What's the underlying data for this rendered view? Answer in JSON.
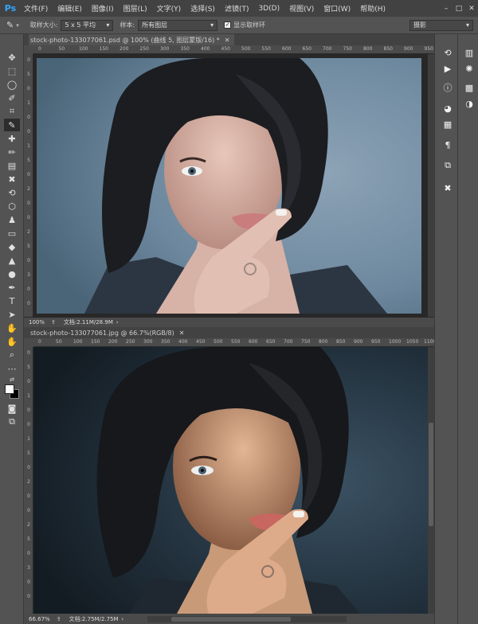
{
  "app": {
    "logo": "Ps"
  },
  "menu": [
    "文件(F)",
    "编辑(E)",
    "图像(I)",
    "图层(L)",
    "文字(Y)",
    "选择(S)",
    "滤镜(T)",
    "3D(D)",
    "视图(V)",
    "窗口(W)",
    "帮助(H)"
  ],
  "options": {
    "sample_size_label": "取样大小:",
    "sample_size_value": "5 x 5 平均",
    "sample_label": "样本:",
    "sample_value": "所有图层",
    "show_ring_label": "显示取样环",
    "workspace_value": "摄影"
  },
  "doc1": {
    "tab_title": "stock-photo-133077061.psd @ 100% (曲线 5, 图层蒙版/16) *",
    "zoom": "100%",
    "doc_size": "文档:2.11M/28.9M",
    "ruler_h": [
      "0",
      "50",
      "100",
      "150",
      "200",
      "250",
      "300",
      "350",
      "400",
      "450",
      "500",
      "550",
      "600",
      "650",
      "700",
      "750",
      "800",
      "850",
      "900",
      "950"
    ],
    "ruler_v": [
      "0",
      "5",
      "0",
      "1",
      "0",
      "0",
      "1",
      "5",
      "0",
      "2",
      "0",
      "0",
      "2",
      "5",
      "0",
      "3",
      "0",
      "0"
    ]
  },
  "doc2": {
    "tab_title": "stock-photo-133077061.jpg @ 66.7%(RGB/8)",
    "zoom": "66.67%",
    "doc_size": "文档:2.75M/2.75M",
    "ruler_h": [
      "0",
      "50",
      "100",
      "150",
      "200",
      "250",
      "300",
      "350",
      "400",
      "450",
      "500",
      "550",
      "600",
      "650",
      "700",
      "750",
      "800",
      "850",
      "900",
      "950",
      "1000",
      "1050",
      "1100"
    ],
    "ruler_v": [
      "0",
      "5",
      "0",
      "1",
      "0",
      "0",
      "1",
      "5",
      "0",
      "2",
      "0",
      "0",
      "2",
      "5",
      "0",
      "3",
      "0",
      "0"
    ]
  },
  "colors": {
    "ui_bg": "#535353",
    "menubar": "#424242",
    "canvas_bg": "#282828",
    "accent": "#31a8ff"
  },
  "tools": [
    "move-icon",
    "marquee-icon",
    "lasso-icon",
    "quick-select-icon",
    "crop-icon",
    "eyedropper-icon",
    "healing-icon",
    "brush-icon",
    "clone-stamp-icon",
    "history-brush-icon",
    "eraser-icon",
    "gradient-icon",
    "blur-icon",
    "dodge-icon",
    "pen-icon",
    "type-icon",
    "path-select-icon",
    "shape-icon",
    "hand-icon",
    "zoom-icon",
    "more-icon"
  ],
  "right_panel_icons": [
    "history-icon",
    "actions-icon",
    "info-icon",
    "color-icon",
    "swatches-icon",
    "character-icon",
    "paragraph-icon",
    "tools-preset-icon",
    "histogram-icon",
    "brightness-icon",
    "adjust-icon",
    "styles-icon"
  ]
}
